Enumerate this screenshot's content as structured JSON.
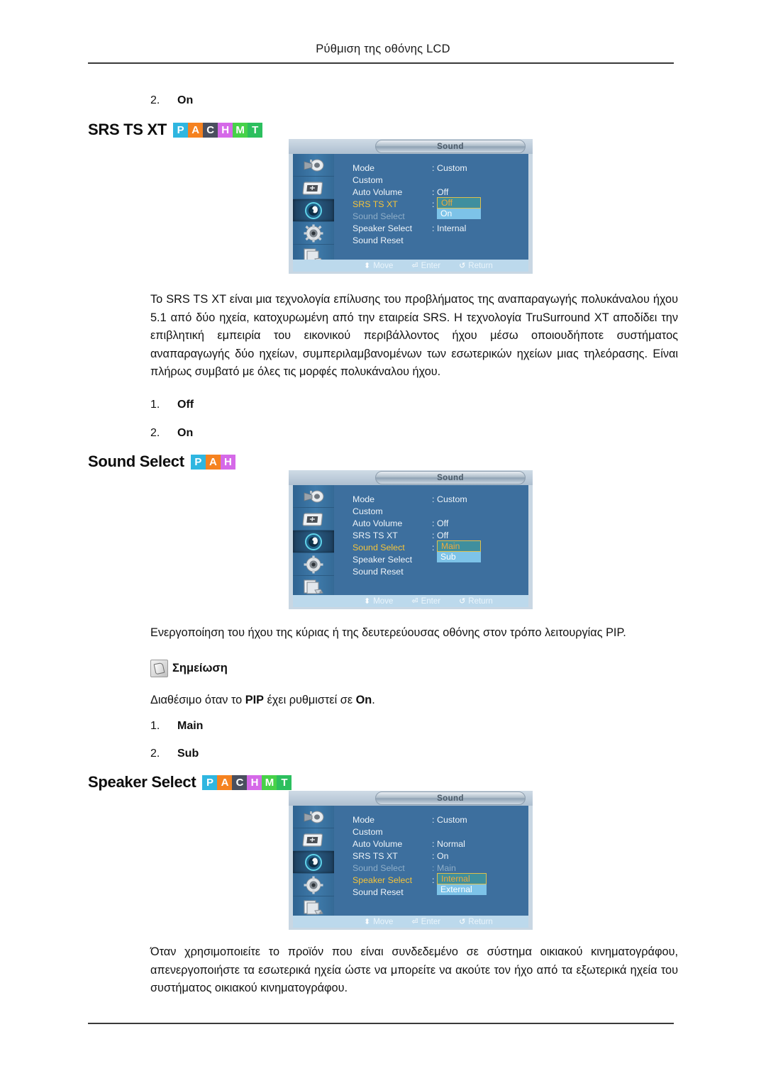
{
  "page": {
    "header": "Ρύθμιση της οθόνης LCD"
  },
  "colors": {
    "badge_P": "#2fb6e0",
    "badge_A": "#f58220",
    "badge_C": "#4a4f5e",
    "badge_H": "#d569e8",
    "badge_M": "#47d149",
    "badge_T": "#2cbf5e",
    "osd_panel": "#3d6f9e",
    "osd_sidebar": "#3f7bab",
    "osd_highlight_label": "#f5c43a",
    "osd_selected_bg": "#3f8f9e",
    "osd_selected_border": "#e0c04a",
    "osd_other_bg": "#7dc3e8",
    "osd_footer_bg": "#bcd9ec"
  },
  "top_list": {
    "items": [
      {
        "num": "2.",
        "label": "On"
      }
    ]
  },
  "sections": [
    {
      "id": "srs-ts-xt",
      "heading": "SRS TS XT",
      "badges": [
        "P",
        "A",
        "C",
        "H",
        "M",
        "T"
      ],
      "paragraph": "Το SRS TS XT είναι μια τεχνολογία επίλυσης του προβλήματος της αναπαραγωγής πολυκάναλου ήχου 5.1 από δύο ηχεία, κατοχυρωμένη από την εταιρεία SRS. Η τεχνολογία TruSurround XT αποδίδει την επιβλητική εμπειρία του εικονικού περιβάλλοντος ήχου μέσω οποιουδήποτε συστήματος αναπαραγωγής δύο ηχείων, συμπεριλαμβανομένων των εσωτερικών ηχείων μιας τηλεόρασης. Είναι πλήρως συμβατό με όλες τις μορφές πολυκάναλου ήχου.",
      "options": [
        {
          "num": "1.",
          "label": "Off"
        },
        {
          "num": "2.",
          "label": "On"
        }
      ]
    },
    {
      "id": "sound-select",
      "heading": "Sound Select",
      "badges": [
        "P",
        "A",
        "H"
      ],
      "paragraph": "Ενεργοποίηση του ήχου της κύριας ή της δευτερεύουσας οθόνης στον τρόπο λειτουργίας PIP.",
      "note_label": "Σημείωση",
      "note_text_pre": "Διαθέσιμο όταν το ",
      "note_text_bold1": "PIP",
      "note_text_mid": " έχει ρυθμιστεί σε ",
      "note_text_bold2": "On",
      "note_text_post": ".",
      "options": [
        {
          "num": "1.",
          "label": "Main"
        },
        {
          "num": "2.",
          "label": "Sub"
        }
      ]
    },
    {
      "id": "speaker-select",
      "heading": "Speaker Select",
      "badges": [
        "P",
        "A",
        "C",
        "H",
        "M",
        "T"
      ],
      "paragraph": "Όταν χρησιμοποιείτε το προϊόν που είναι συνδεδεμένο σε σύστημα οικιακού κινηματογράφου, απενεργοποιήστε τα εσωτερικά ηχεία ώστε να μπορείτε να ακούτε τον ήχο από τα εξωτερικά ηχεία του συστήματος οικιακού κινηματογράφου."
    }
  ],
  "osd_screens": [
    {
      "id": "osd-srs",
      "title": "Sound",
      "sidebar_icons": [
        "input-source-icon",
        "picture-icon",
        "sound-icon",
        "setup-gear-icon",
        "multi-control-icon"
      ],
      "active_icon_index": 2,
      "rows": [
        {
          "label": "Mode",
          "value": "Custom",
          "state": "normal"
        },
        {
          "label": "Custom",
          "value": "",
          "state": "normal"
        },
        {
          "label": "Auto Volume",
          "value": "Off",
          "state": "normal"
        },
        {
          "label": "SRS TS XT",
          "value": "",
          "state": "selected"
        },
        {
          "label": "Sound Select",
          "value": "",
          "state": "dim"
        },
        {
          "label": "Speaker Select",
          "value": "Internal",
          "state": "normal"
        },
        {
          "label": "Sound Reset",
          "value": "",
          "state": "normal"
        }
      ],
      "popup": {
        "row_index": 3,
        "current": "Off",
        "other": "On"
      },
      "footer": [
        {
          "glyph": "⬍",
          "label": "Move"
        },
        {
          "glyph": "⏎",
          "label": "Enter"
        },
        {
          "glyph": "↺",
          "label": "Return"
        }
      ]
    },
    {
      "id": "osd-sound-select",
      "title": "Sound",
      "sidebar_icons": [
        "input-source-icon",
        "picture-icon",
        "sound-icon",
        "setup-gear-icon",
        "multi-control-icon"
      ],
      "active_icon_index": 2,
      "rows": [
        {
          "label": "Mode",
          "value": "Custom",
          "state": "normal"
        },
        {
          "label": "Custom",
          "value": "",
          "state": "normal"
        },
        {
          "label": "Auto Volume",
          "value": "Off",
          "state": "normal"
        },
        {
          "label": "SRS TS XT",
          "value": "Off",
          "state": "normal"
        },
        {
          "label": "Sound Select",
          "value": "",
          "state": "selected"
        },
        {
          "label": "Speaker Select",
          "value": "",
          "state": "normal"
        },
        {
          "label": "Sound Reset",
          "value": "",
          "state": "normal"
        }
      ],
      "popup": {
        "row_index": 4,
        "current": "Main",
        "other": "Sub"
      },
      "footer": [
        {
          "glyph": "⬍",
          "label": "Move"
        },
        {
          "glyph": "⏎",
          "label": "Enter"
        },
        {
          "glyph": "↺",
          "label": "Return"
        }
      ]
    },
    {
      "id": "osd-speaker-select",
      "title": "Sound",
      "sidebar_icons": [
        "input-source-icon",
        "picture-icon",
        "sound-icon",
        "setup-gear-icon",
        "multi-control-icon"
      ],
      "active_icon_index": 2,
      "rows": [
        {
          "label": "Mode",
          "value": "Custom",
          "state": "normal"
        },
        {
          "label": "Custom",
          "value": "",
          "state": "normal"
        },
        {
          "label": "Auto Volume",
          "value": "Normal",
          "state": "normal"
        },
        {
          "label": "SRS TS XT",
          "value": "On",
          "state": "normal"
        },
        {
          "label": "Sound Select",
          "value": "Main",
          "state": "dim"
        },
        {
          "label": "Speaker Select",
          "value": "",
          "state": "selected"
        },
        {
          "label": "Sound Reset",
          "value": "",
          "state": "normal"
        }
      ],
      "popup": {
        "row_index": 5,
        "current": "Internal",
        "other": "External"
      },
      "footer": [
        {
          "glyph": "⬍",
          "label": "Move"
        },
        {
          "glyph": "⏎",
          "label": "Enter"
        },
        {
          "glyph": "↺",
          "label": "Return"
        }
      ]
    }
  ]
}
